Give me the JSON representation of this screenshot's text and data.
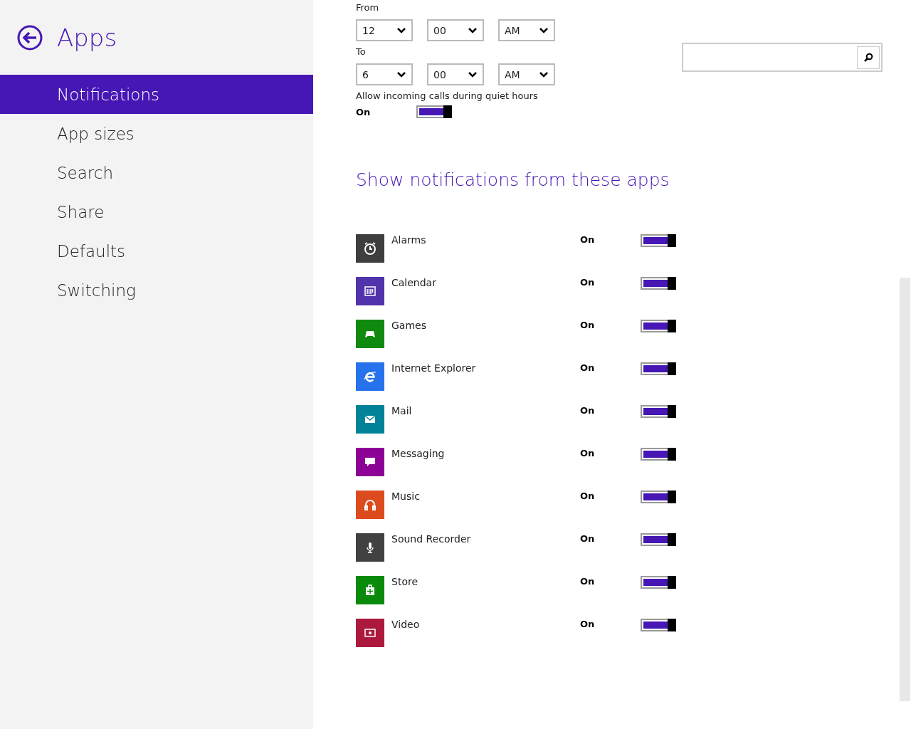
{
  "sidebar": {
    "title": "Apps",
    "items": [
      {
        "label": "Notifications",
        "selected": true
      },
      {
        "label": "App sizes",
        "selected": false
      },
      {
        "label": "Search",
        "selected": false
      },
      {
        "label": "Share",
        "selected": false
      },
      {
        "label": "Defaults",
        "selected": false
      },
      {
        "label": "Switching",
        "selected": false
      }
    ]
  },
  "quiet_hours": {
    "from_label": "From",
    "from": [
      "12",
      "00",
      "AM"
    ],
    "to_label": "To",
    "to": [
      "6",
      "00",
      "AM"
    ],
    "calls": {
      "label": "Allow incoming calls during quiet hours",
      "state_label": "On",
      "on": true
    }
  },
  "apps_section": {
    "heading": "Show notifications from these apps",
    "apps": [
      {
        "name": "Alarms",
        "color": "#3e3e3e",
        "state_label": "On",
        "on": true
      },
      {
        "name": "Calendar",
        "color": "#5133ab",
        "state_label": "On",
        "on": true
      },
      {
        "name": "Games",
        "color": "#0f8a0f",
        "state_label": "On",
        "on": true
      },
      {
        "name": "Internet Explorer",
        "color": "#2672ec",
        "state_label": "On",
        "on": true
      },
      {
        "name": "Mail",
        "color": "#008299",
        "state_label": "On",
        "on": true
      },
      {
        "name": "Messaging",
        "color": "#8c0095",
        "state_label": "On",
        "on": true
      },
      {
        "name": "Music",
        "color": "#dc4b1e",
        "state_label": "On",
        "on": true
      },
      {
        "name": "Sound Recorder",
        "color": "#414141",
        "state_label": "On",
        "on": true
      },
      {
        "name": "Store",
        "color": "#0a8a0a",
        "state_label": "On",
        "on": true
      },
      {
        "name": "Video",
        "color": "#ac193d",
        "state_label": "On",
        "on": true
      }
    ]
  }
}
